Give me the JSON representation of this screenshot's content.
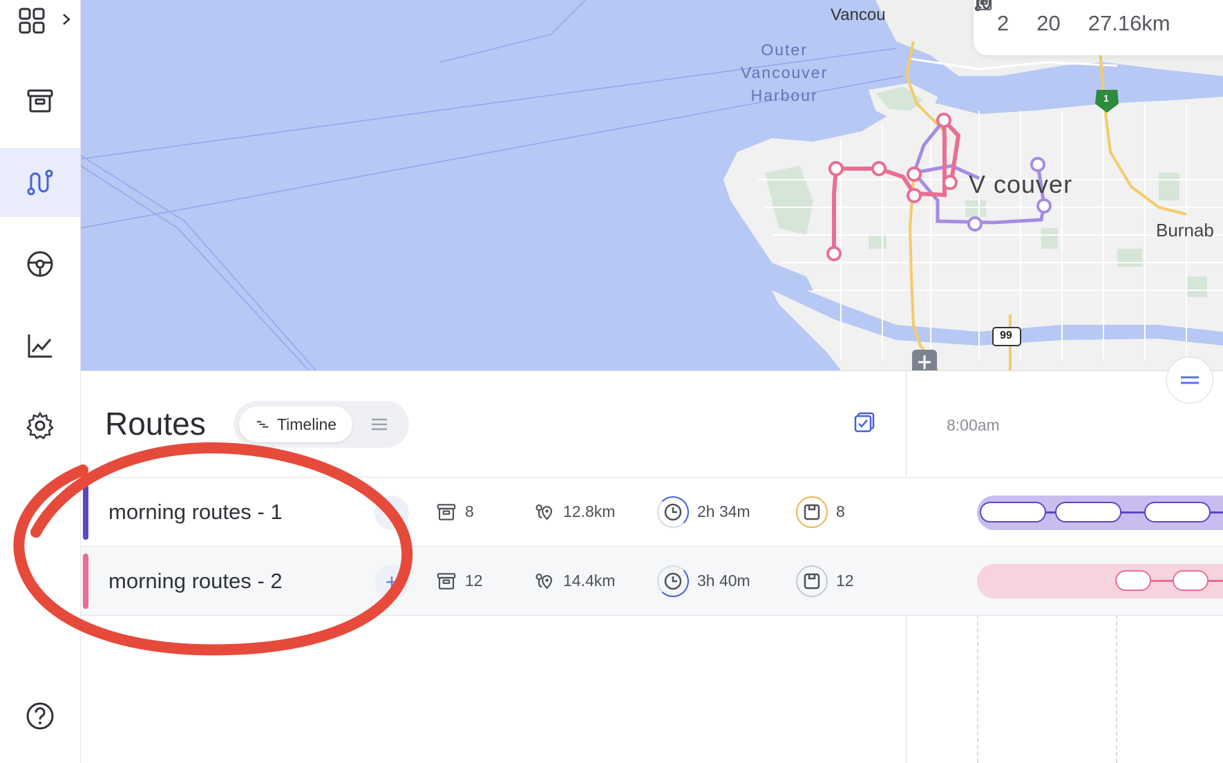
{
  "sidebar": {
    "items": [
      {
        "icon": "apps-grid-icon",
        "label": "Apps"
      },
      {
        "icon": "package-icon",
        "label": "Orders"
      },
      {
        "icon": "route-icon",
        "label": "Routes"
      },
      {
        "icon": "steering-wheel-icon",
        "label": "Drivers"
      },
      {
        "icon": "analytics-icon",
        "label": "Analytics"
      },
      {
        "icon": "settings-icon",
        "label": "Settings"
      },
      {
        "icon": "help-icon",
        "label": "Help"
      }
    ],
    "active": "Routes"
  },
  "map": {
    "labels": {
      "harbour": "Outer\nVancouver\nHarbour",
      "city_partial_top": "Vancou",
      "city": "V  couver",
      "burnaby_partial": "Burnab",
      "highway_99": "99",
      "highway_1": "1"
    },
    "summary": {
      "routes_count": "2",
      "stops_count": "20",
      "total_distance": "27.16km"
    },
    "colors": {
      "water": "#b6c8f3",
      "land": "#f1f1f1",
      "park": "#d5e6d8",
      "highway": "#f4ca6a",
      "route1": "#a58ce3",
      "route2": "#ea6e92"
    }
  },
  "panel": {
    "title": "Routes",
    "view_toggle": {
      "timeline_label": "Timeline",
      "active": "Timeline"
    },
    "timeline_start": "8:00am"
  },
  "routes": [
    {
      "name": "morning routes - 1",
      "color": "#5a47c2",
      "stops": "8",
      "distance": "12.8km",
      "duration": "2h 34m",
      "capacity": "8",
      "capacity_ring_color": "#f0b54c"
    },
    {
      "name": "morning routes - 2",
      "color": "#ea6e92",
      "stops": "12",
      "distance": "14.4km",
      "duration": "3h 40m",
      "capacity": "12",
      "capacity_ring_color": "#c6c9d0"
    }
  ],
  "annotation": {
    "color": "#e64a3b"
  }
}
